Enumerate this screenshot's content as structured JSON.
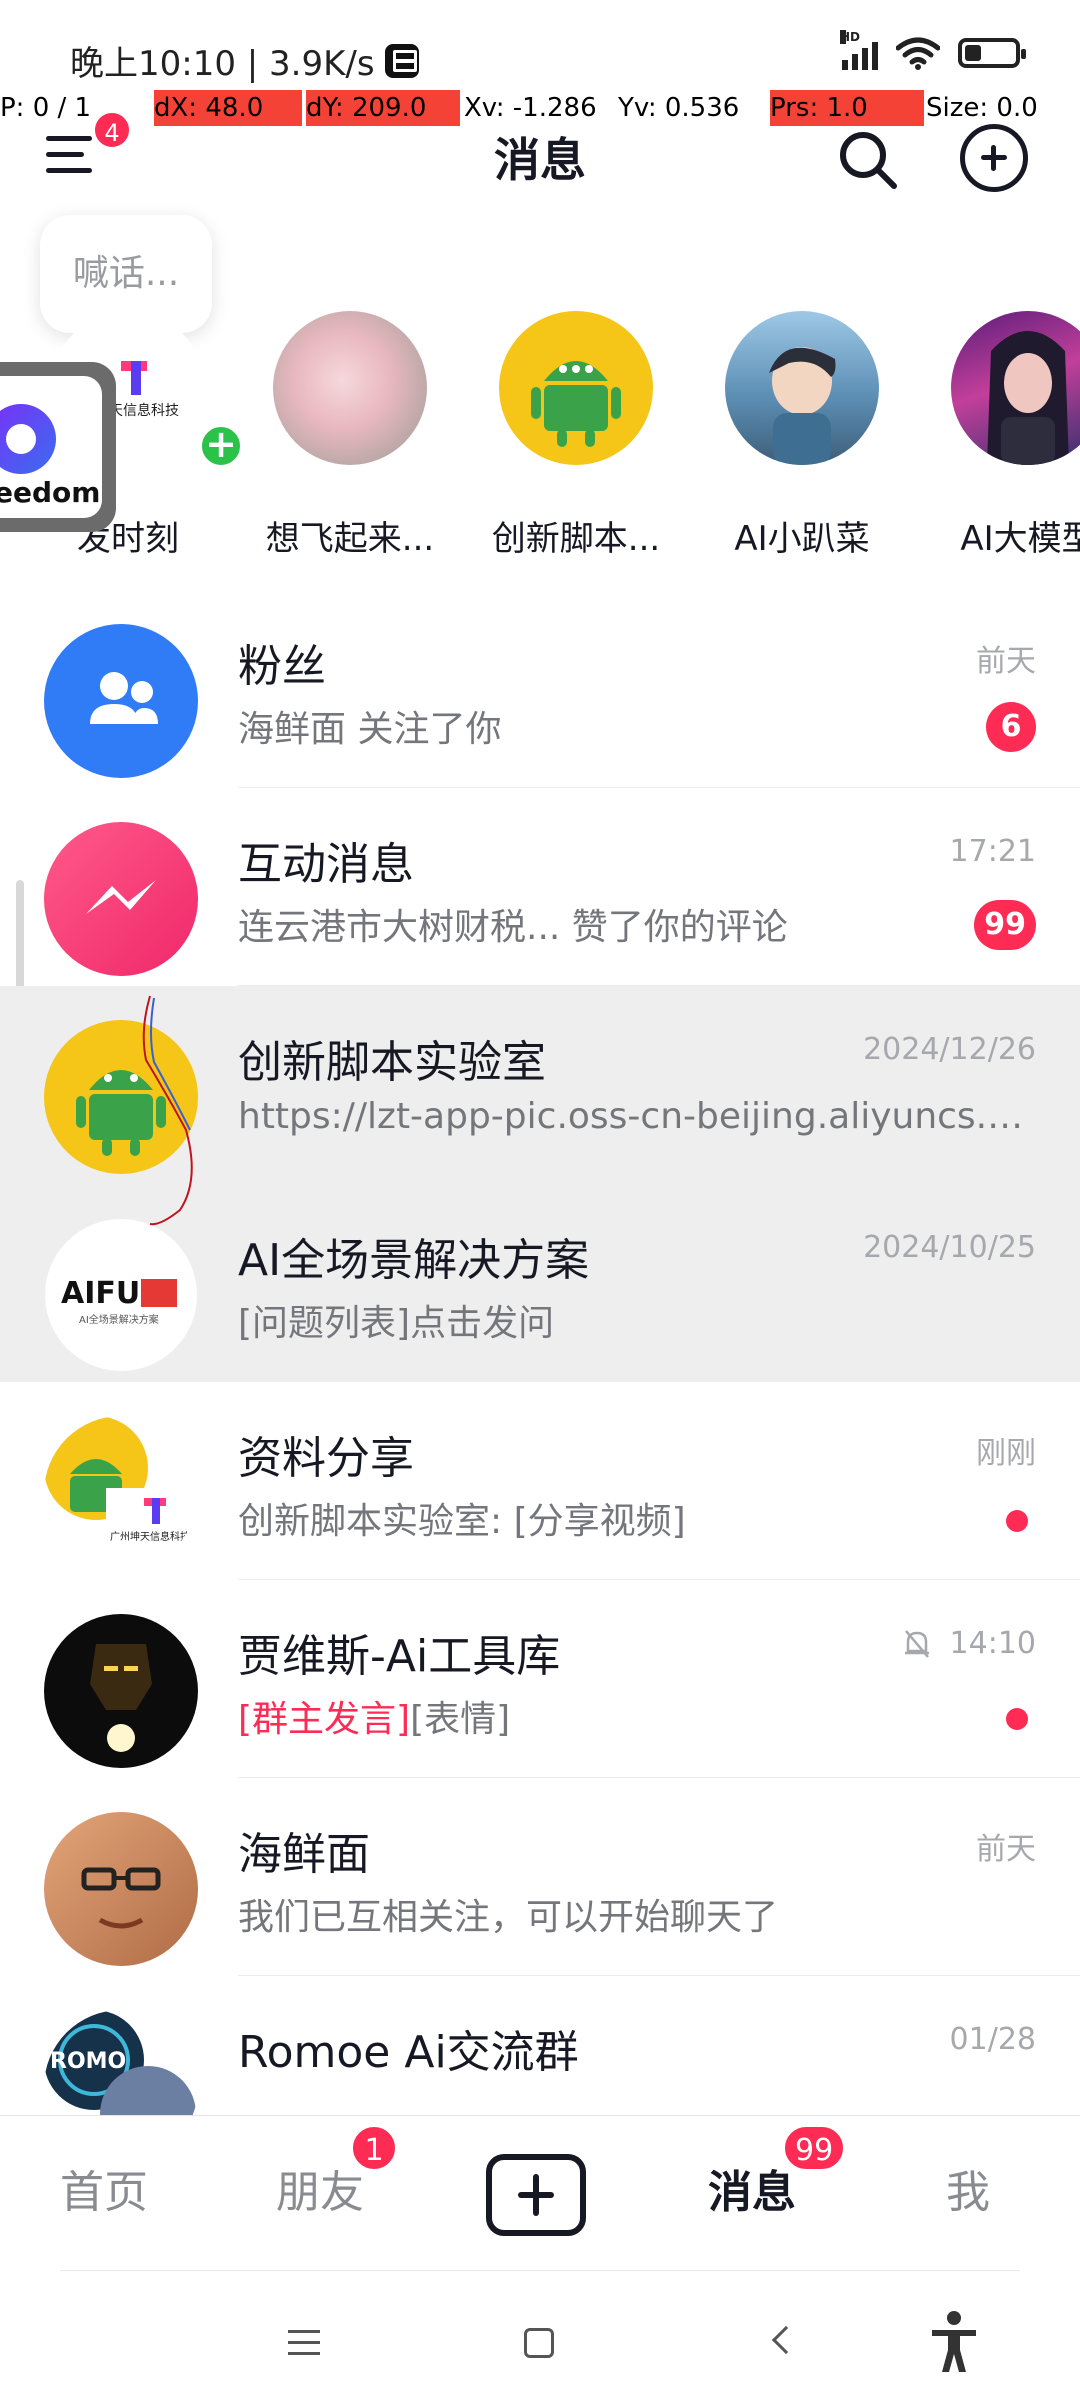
{
  "status_bar": {
    "left_text": "晚上10:10 | 3.9K/s",
    "hd": "HD"
  },
  "debug": {
    "p": "P: 0 / 1",
    "dx": "dX: 48.0",
    "dy": "dY: 209.0",
    "xv": "Xv: -1.286",
    "yv": "Yv: 0.536",
    "prs": "Prs: 1.0",
    "size": "Size: 0.0"
  },
  "header": {
    "title": "消息",
    "menu_badge": "4"
  },
  "stories": {
    "bubble": "喊话...",
    "items": [
      {
        "name": "发时刻"
      },
      {
        "name": "想飞起来..."
      },
      {
        "name": "创新脚本..."
      },
      {
        "name": "AI小趴菜"
      },
      {
        "name": "AI大模型"
      }
    ],
    "logo_texts": [
      "州坤天信息科技",
      "eedom"
    ]
  },
  "conversations": [
    {
      "title": "粉丝",
      "subtitle": "海鲜面 关注了你",
      "time": "前天",
      "badge": "6"
    },
    {
      "title": "互动消息",
      "subtitle": "连云港市大树财税... 赞了你的评论",
      "time": "17:21",
      "badge": "99"
    },
    {
      "title": "创新脚本实验室",
      "subtitle": "https://lzt-app-pic.oss-cn-beijing.aliyuncs.com/",
      "time": "2024/12/26"
    },
    {
      "title": "AI全场景解决方案",
      "subtitle": "[问题列表]点击发问",
      "time": "2024/10/25",
      "logo_text": "AIFU",
      "logo_sub": "AI全场景解决方案"
    },
    {
      "title": "资料分享",
      "subtitle": "创新脚本实验室: [分享视频]",
      "time": "刚刚",
      "logo_text": "广州坤天信息科技"
    },
    {
      "title": "贾维斯-Ai工具库",
      "subtitle_hot": "[群主发言]",
      "subtitle": "[表情]",
      "time": "14:10"
    },
    {
      "title": "海鲜面",
      "subtitle": "我们已互相关注，可以开始聊天了",
      "time": "前天"
    },
    {
      "title": "Romoe Ai交流群",
      "subtitle": "",
      "time": "01/28",
      "logo_text": "ROMO"
    }
  ],
  "bottom_nav": {
    "home": "首页",
    "friends": "朋友",
    "friends_badge": "1",
    "messages": "消息",
    "messages_badge": "99",
    "me": "我"
  },
  "colors": {
    "accent": "#fe2c55",
    "blue": "#2f7cf6",
    "android_green": "#3aa34a",
    "android_yellow": "#f5c518"
  }
}
